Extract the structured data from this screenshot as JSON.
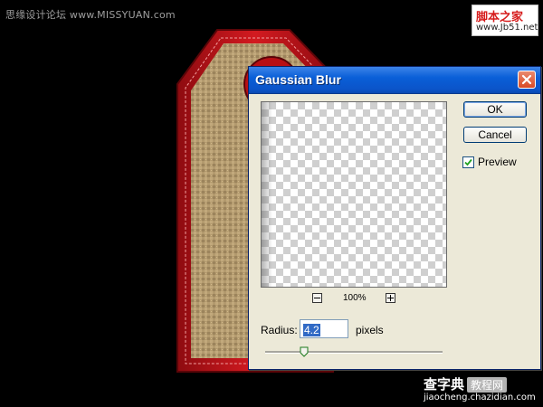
{
  "watermark": {
    "top_left_prefix": "思缘设计论坛",
    "top_left_url": "www.MISSYUAN.com",
    "top_right_line1": "脚本之家",
    "top_right_line2": "www.Jb51.net",
    "bottom_brand": "查字典",
    "bottom_badge": "教程网",
    "bottom_url": "jiaocheng.chazidian.com"
  },
  "dialog": {
    "title": "Gaussian Blur",
    "ok_label": "OK",
    "cancel_label": "Cancel",
    "preview_label": "Preview",
    "preview_checked": true,
    "zoom_level": "100%",
    "radius_label": "Radius:",
    "radius_value": "4.2",
    "radius_unit": "pixels"
  },
  "colors": {
    "titlebar": "#0a5fd8",
    "dialog_bg": "#ece9d8",
    "tag_red": "#c8141a",
    "burlap": "#b39a6e"
  },
  "icons": {
    "close": "close-icon",
    "zoom_out": "minus-icon",
    "zoom_in": "plus-icon",
    "check": "check-icon",
    "slider_thumb": "slider-thumb-icon"
  }
}
